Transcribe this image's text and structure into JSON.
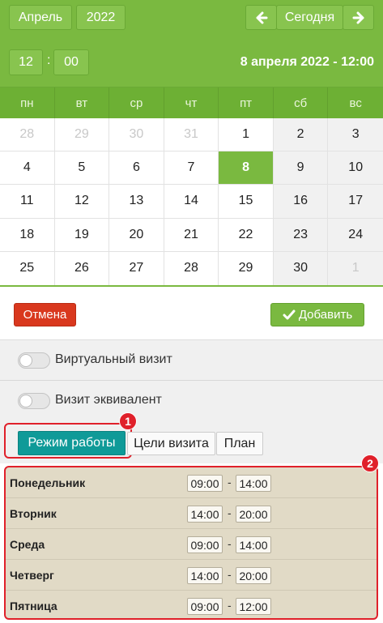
{
  "header": {
    "month": "Апрель",
    "year": "2022",
    "today": "Сегодня",
    "prev_icon": "arrow-left-icon",
    "next_icon": "arrow-right-icon",
    "hour": "12",
    "minute": "00",
    "time_separator": ":",
    "selected_datetime": "8 апреля 2022 - 12:00"
  },
  "calendar": {
    "weekdays": [
      "пн",
      "вт",
      "ср",
      "чт",
      "пт",
      "сб",
      "вс"
    ],
    "days": [
      "28",
      "29",
      "30",
      "31",
      "1",
      "2",
      "3",
      "4",
      "5",
      "6",
      "7",
      "8",
      "9",
      "10",
      "11",
      "12",
      "13",
      "14",
      "15",
      "16",
      "17",
      "18",
      "19",
      "20",
      "21",
      "22",
      "23",
      "24",
      "25",
      "26",
      "27",
      "28",
      "29",
      "30",
      "1"
    ],
    "selected": "8"
  },
  "actions": {
    "cancel": "Отмена",
    "add": "Добавить",
    "add_icon": "check-icon"
  },
  "toggles": [
    {
      "label": "Виртуальный визит"
    },
    {
      "label": "Визит эквивалент"
    }
  ],
  "tabs": {
    "active": "Режим работы",
    "goals": "Цели визита",
    "plan": "План"
  },
  "annotations": {
    "badge1": "1",
    "badge2": "2"
  },
  "schedule": [
    {
      "day": "Понедельник",
      "from": "09:00",
      "to": "14:00"
    },
    {
      "day": "Вторник",
      "from": "14:00",
      "to": "20:00"
    },
    {
      "day": "Среда",
      "from": "09:00",
      "to": "14:00"
    },
    {
      "day": "Четверг",
      "from": "14:00",
      "to": "20:00"
    },
    {
      "day": "Пятница",
      "from": "09:00",
      "to": "12:00"
    }
  ],
  "schedule_separator": "-",
  "colors": {
    "green": "#7ab940",
    "teal": "#0f9a98",
    "red": "#d9381e",
    "highlight_red": "#e0202a",
    "schedule_bg": "#e1dac6"
  }
}
